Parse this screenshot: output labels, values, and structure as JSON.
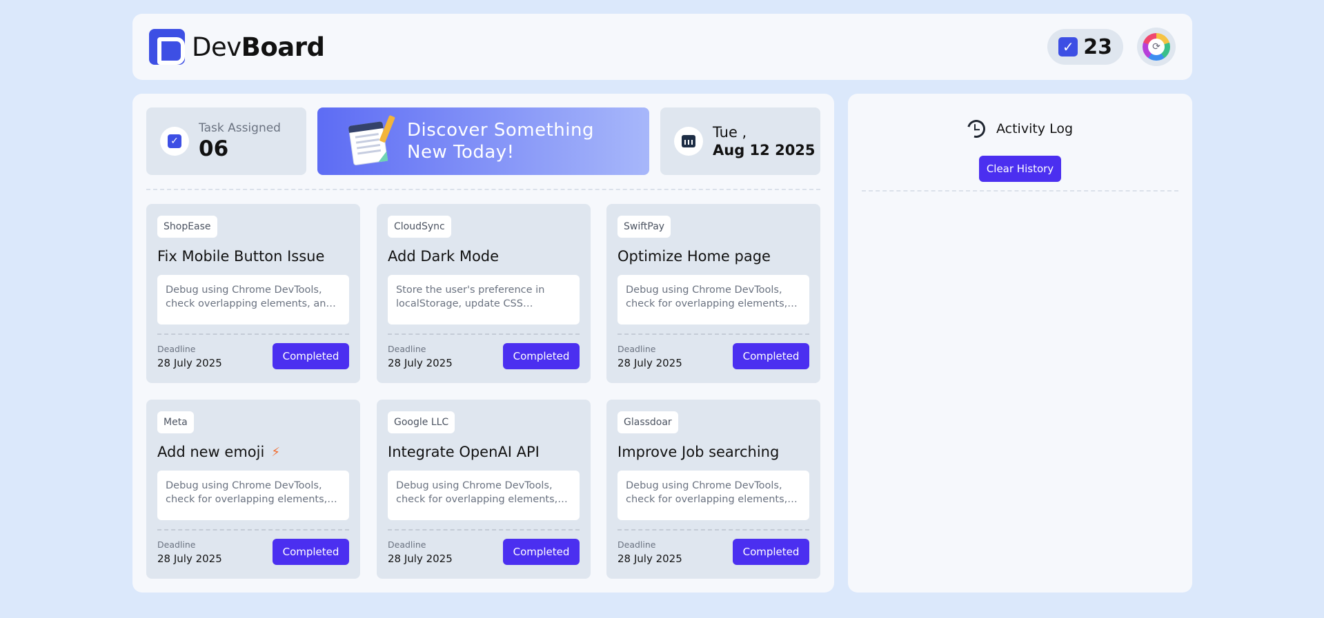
{
  "header": {
    "logo_dev": "Dev",
    "logo_board": "Board",
    "task_count": "23"
  },
  "stats": {
    "task_label": "Task Assigned",
    "task_value": "06",
    "banner_line1": "Discover Something",
    "banner_line2": "New Today!",
    "day": "Tue ,",
    "date": "Aug 12 2025"
  },
  "tasks": [
    {
      "company": "ShopEase",
      "title": "Fix Mobile Button Issue",
      "desc": "Debug using Chrome DevTools, check overlapping elements, and fix CSS z-index issues.",
      "deadline_label": "Deadline",
      "deadline": "28 July 2025",
      "status": "Completed"
    },
    {
      "company": "CloudSync",
      "title": "Add Dark Mode",
      "desc": "Store the user's preference in localStorage, update CSS variables for the theme.",
      "deadline_label": "Deadline",
      "deadline": "28 July 2025",
      "status": "Completed"
    },
    {
      "company": "SwiftPay",
      "title": "Optimize Home page",
      "desc": "Debug using Chrome DevTools, check for overlapping elements, and compress assets.",
      "deadline_label": "Deadline",
      "deadline": "28 July 2025",
      "status": "Completed"
    },
    {
      "company": "Meta",
      "title": "Add new emoji",
      "desc": "Debug using Chrome DevTools, check for overlapping elements, and update the picker.",
      "deadline_label": "Deadline",
      "deadline": "28 July 2025",
      "status": "Completed"
    },
    {
      "company": "Google LLC",
      "title": "Integrate OpenAI API",
      "desc": "Debug using Chrome DevTools, check for overlapping elements, and wire up the API.",
      "deadline_label": "Deadline",
      "deadline": "28 July 2025",
      "status": "Completed"
    },
    {
      "company": "Glassdoar",
      "title": "Improve Job searching",
      "desc": "Debug using Chrome DevTools, check for overlapping elements, and refine filters.",
      "deadline_label": "Deadline",
      "deadline": "28 July 2025",
      "status": "Completed"
    }
  ],
  "activity": {
    "title": "Activity Log",
    "clear_label": "Clear History"
  },
  "icons": {
    "bolt": "lightning-icon",
    "history": "history-icon",
    "calendar": "calendar-icon",
    "check": "checkbox-icon"
  },
  "colors": {
    "accent": "#4b2ff0",
    "logo": "#3d4fe4",
    "background": "#dbe8fb",
    "card": "#dfe6ef"
  }
}
